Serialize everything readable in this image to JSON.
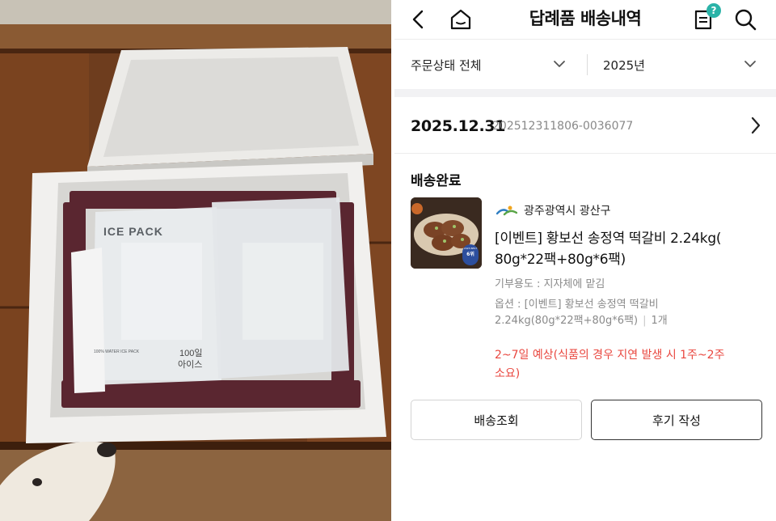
{
  "header": {
    "title": "답례품 배송내역",
    "badge": "?"
  },
  "filters": {
    "order_status": "주문상태 전체",
    "year": "2025년"
  },
  "order": {
    "date": "2025.12.31",
    "order_number": "202512311806-0036077",
    "status": "배송완료",
    "region": "광주광역시 광산구",
    "product_name": "[이벤트] 황보선 송정역 떡갈비 2.24kg( 80g*22팩+80g*6팩)",
    "donation_use": "기부용도 : 지자체에 맡김",
    "option": "옵션 : [이벤트] 황보선 송정역 떡갈비 2.24kg(80g*22팩+80g*6팩)",
    "quantity": "1개",
    "delivery_estimate": "2~7일 예상(식품의 경우 지연 발생 시 1주~2주 소요)",
    "thumb_badge_top": "2025 BEST",
    "thumb_badge_rank": "6위"
  },
  "buttons": {
    "track": "배송조회",
    "review": "후기 작성"
  },
  "photo": {
    "ice_pack_brand": "100% WATER ICE PACK",
    "ice_pack_title": "ICE PACK",
    "ice_pack_label": "100일",
    "ice_pack_sub": "아이스"
  },
  "colors": {
    "accent_teal": "#2bb3a8",
    "notice_red": "#e9473f",
    "text_grey": "#8a8a8a"
  },
  "icons": [
    "back-arrow-icon",
    "home-icon",
    "receipt-icon",
    "search-icon",
    "chevron-down-icon",
    "chevron-right-icon"
  ]
}
